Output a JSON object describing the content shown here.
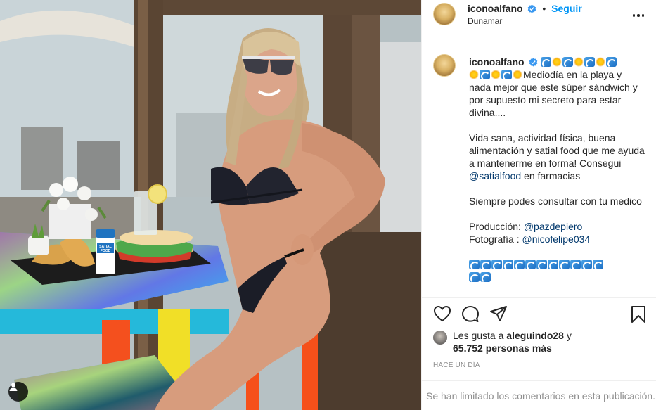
{
  "post": {
    "username": "iconoalfano",
    "follow_label": "Seguir",
    "separator": "•",
    "location": "Dunamar",
    "caption": {
      "line1_text": "Mediodía en la playa y nada mejor que este súper sándwich y por supuesto mi secreto para estar divina....",
      "para2": "Vida sana, actividad física, buena alimentación y satial food que me ayuda a mantenerme en forma! Consegui",
      "para2_mention": "@satialfood",
      "para2_tail": " en farmacias",
      "para3": "Siempre podes consultar con tu medico",
      "produccion_label": "Producción: ",
      "produccion_mention": "@pazdepiero",
      "fotografia_label": "Fotografía : ",
      "fotografia_mention": "@nicofelipe034"
    },
    "likes": {
      "prefix": "Les gusta a ",
      "user": "aleguindo28",
      "middle": " y",
      "count": "65.752 personas más"
    },
    "time_ago": "HACE UN DÍA",
    "comments_limited": "Se han limitado los comentarios en esta publicación."
  },
  "photo_product_label": "SATIAL FOOD",
  "icons": {
    "verified": "verified-badge-icon",
    "more": "more-options-icon",
    "like": "heart-icon",
    "comment": "comment-bubble-icon",
    "share": "paper-plane-icon",
    "save": "bookmark-icon",
    "tag": "user-tag-icon"
  },
  "colors": {
    "accent": "#0095f6",
    "mention": "#00376b",
    "muted": "#8e8e8e",
    "border": "#efefef"
  }
}
